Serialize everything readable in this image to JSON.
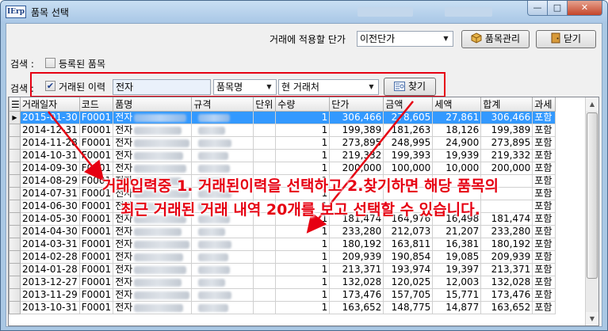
{
  "window": {
    "title": "품목 선택",
    "app_icon_text": "IErp",
    "min_glyph": "—",
    "max_glyph": "□",
    "close_glyph": "✕"
  },
  "toolbar": {
    "price_label": "거래에 적용할 단가",
    "price_select_value": "이전단가",
    "manage_button": "품목관리",
    "close_button": "닫기"
  },
  "search1": {
    "label": "검색 :",
    "checkbox_label": "등록된 품목",
    "checked": false
  },
  "search2": {
    "label": "검색 :",
    "checkbox_label": "거래된 이력",
    "checked": true,
    "keyword": "전자",
    "field_select": "품목명",
    "scope_select": "현 거래처",
    "find_button": "찾기"
  },
  "colors": {
    "accent_red": "#e60012",
    "selection": "#3399ff"
  },
  "grid": {
    "columns": [
      "거래일자",
      "코드",
      "품명",
      "규격",
      "단위",
      "수량",
      "단가",
      "금액",
      "세액",
      "합계",
      "과세"
    ],
    "rows": [
      [
        "2015-01-30",
        "F0001",
        "전자",
        "",
        "",
        "1",
        "306,466",
        "278,605",
        "27,861",
        "306,466",
        "포함"
      ],
      [
        "2014-12-31",
        "F0001",
        "전자",
        "",
        "",
        "1",
        "199,389",
        "181,263",
        "18,126",
        "199,389",
        "포함"
      ],
      [
        "2014-11-28",
        "F0001",
        "전자",
        "",
        "",
        "1",
        "273,895",
        "248,995",
        "24,900",
        "273,895",
        "포함"
      ],
      [
        "2014-10-31",
        "F0001",
        "전자",
        "",
        "",
        "1",
        "219,332",
        "199,393",
        "19,939",
        "219,332",
        "포함"
      ],
      [
        "2014-09-30",
        "F0001",
        "전자",
        "",
        "",
        "1",
        "200,000",
        "100,000",
        "10,000",
        "200,000",
        "포함"
      ],
      [
        "2014-08-29",
        "F0001",
        "전자",
        "",
        "",
        "1",
        "",
        "",
        "",
        "",
        "포함"
      ],
      [
        "2014-07-31",
        "F0001",
        "전자",
        "",
        "",
        "1",
        "",
        "",
        "",
        "",
        "포함"
      ],
      [
        "2014-06-30",
        "F0001",
        "전자",
        "",
        "",
        "1",
        "",
        "",
        "",
        "",
        "포함"
      ],
      [
        "2014-05-30",
        "F0001",
        "전자",
        "",
        "",
        "1",
        "181,474",
        "164,976",
        "16,498",
        "181,474",
        "포함"
      ],
      [
        "2014-04-30",
        "F0001",
        "전자",
        "",
        "",
        "1",
        "233,280",
        "212,073",
        "21,207",
        "233,280",
        "포함"
      ],
      [
        "2014-03-31",
        "F0001",
        "전자",
        "",
        "",
        "1",
        "180,192",
        "163,811",
        "16,381",
        "180,192",
        "포함"
      ],
      [
        "2014-02-28",
        "F0001",
        "전자",
        "",
        "",
        "1",
        "209,939",
        "190,854",
        "19,085",
        "209,939",
        "포함"
      ],
      [
        "2014-01-28",
        "F0001",
        "전자",
        "",
        "",
        "1",
        "213,371",
        "193,974",
        "19,397",
        "213,371",
        "포함"
      ],
      [
        "2013-12-27",
        "F0001",
        "전자",
        "",
        "",
        "1",
        "132,028",
        "120,025",
        "12,003",
        "132,028",
        "포함"
      ],
      [
        "2013-11-29",
        "F0001",
        "전자",
        "",
        "",
        "1",
        "173,476",
        "157,705",
        "15,771",
        "173,476",
        "포함"
      ],
      [
        "2013-10-31",
        "F0001",
        "전자",
        "",
        "",
        "1",
        "163,652",
        "148,775",
        "14,877",
        "163,652",
        "포함"
      ]
    ]
  },
  "annotation": {
    "line1": "거래입력중 1. 거래된이력을 선택하고 2.찾기하면 해당 품목의",
    "line2": "최근 거래된 거래 내역 20개를 보고 선택할 수 있습니다."
  }
}
